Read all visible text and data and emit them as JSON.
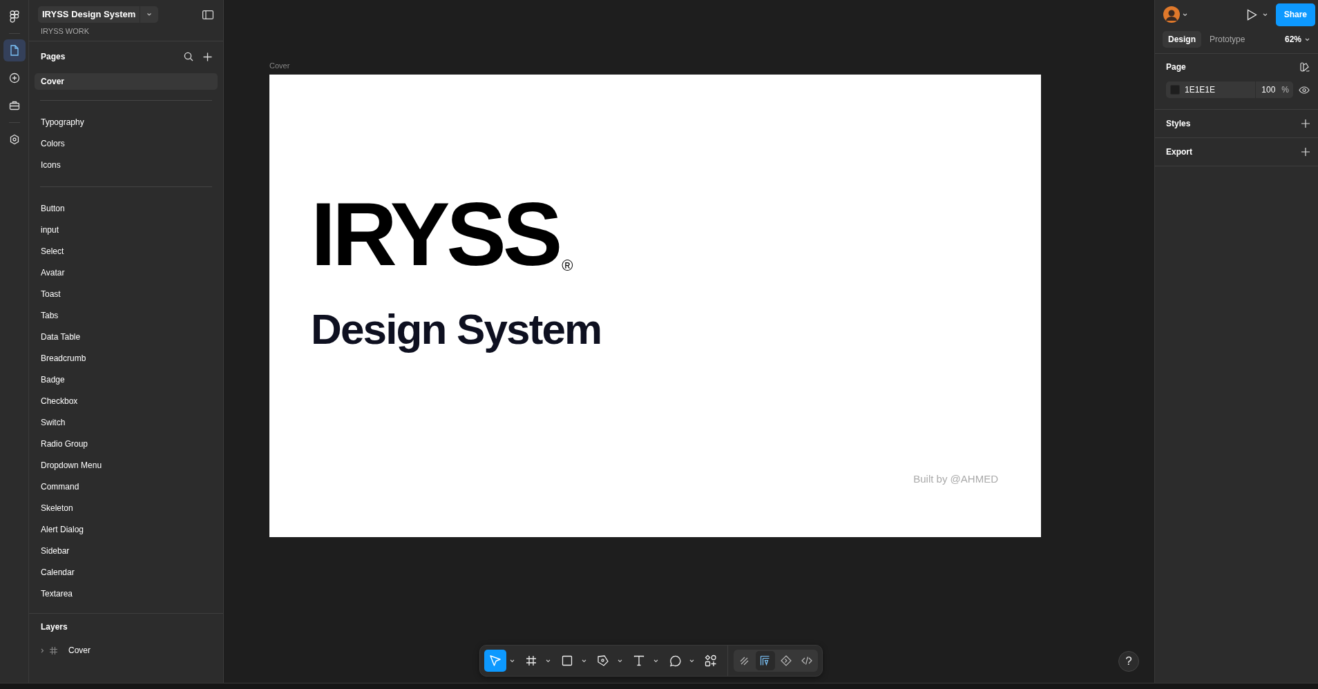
{
  "rail": [
    {
      "kind": "logo",
      "selected": false
    },
    {
      "kind": "file",
      "selected": true
    },
    {
      "kind": "add",
      "selected": false
    },
    {
      "kind": "kit",
      "selected": false
    },
    {
      "kind": "plugin",
      "selected": false
    }
  ],
  "file": {
    "name": "IRYSS Design System",
    "team": "IRYSS WORK"
  },
  "pages": {
    "title": "Pages",
    "groups": [
      {
        "items": [
          {
            "label": "Cover",
            "selected": true
          }
        ]
      },
      {
        "items": [
          {
            "label": "Typography",
            "selected": false
          },
          {
            "label": "Colors",
            "selected": false
          },
          {
            "label": "Icons",
            "selected": false
          }
        ]
      },
      {
        "items": [
          {
            "label": "Button",
            "selected": false
          },
          {
            "label": "input",
            "selected": false
          },
          {
            "label": "Select",
            "selected": false
          },
          {
            "label": "Avatar",
            "selected": false
          },
          {
            "label": "Toast",
            "selected": false
          },
          {
            "label": "Tabs",
            "selected": false
          },
          {
            "label": "Data Table",
            "selected": false
          },
          {
            "label": "Breadcrumb",
            "selected": false
          },
          {
            "label": "Badge",
            "selected": false
          },
          {
            "label": "Checkbox",
            "selected": false
          },
          {
            "label": "Switch",
            "selected": false
          },
          {
            "label": "Radio Group",
            "selected": false
          },
          {
            "label": "Dropdown Menu",
            "selected": false
          },
          {
            "label": "Command",
            "selected": false
          },
          {
            "label": "Skeleton",
            "selected": false
          },
          {
            "label": "Alert Dialog",
            "selected": false
          },
          {
            "label": "Sidebar",
            "selected": false
          },
          {
            "label": "Calendar",
            "selected": false
          },
          {
            "label": "Textarea",
            "selected": false
          }
        ]
      }
    ]
  },
  "layers": {
    "title": "Layers",
    "items": [
      {
        "label": "Cover",
        "expanded": false
      }
    ]
  },
  "canvas": {
    "frame_label": "Cover",
    "title": "IRYSS",
    "mark": "®",
    "subtitle": "Design System",
    "credit": "Built by @AHMED"
  },
  "toolbar": {
    "tools": [
      {
        "kind": "move",
        "selected": true
      },
      {
        "kind": "frame",
        "selected": false
      },
      {
        "kind": "rect",
        "selected": false
      },
      {
        "kind": "pen",
        "selected": false
      },
      {
        "kind": "text",
        "selected": false
      },
      {
        "kind": "comment",
        "selected": false
      },
      {
        "kind": "actions",
        "selected": false
      }
    ],
    "modes": [
      {
        "kind": "draw",
        "selected": false
      },
      {
        "kind": "design",
        "selected": true
      },
      {
        "kind": "dev",
        "selected": false
      },
      {
        "kind": "code",
        "selected": false
      }
    ]
  },
  "inspector": {
    "share": "Share",
    "tabs": [
      {
        "label": "Design",
        "selected": true
      },
      {
        "label": "Prototype",
        "selected": false
      }
    ],
    "zoom": "62%",
    "page": {
      "title": "Page",
      "color": "1E1E1E",
      "opacity": "100",
      "unit": "%"
    },
    "sections": [
      {
        "title": "Styles"
      },
      {
        "title": "Export"
      }
    ]
  },
  "help": "?"
}
